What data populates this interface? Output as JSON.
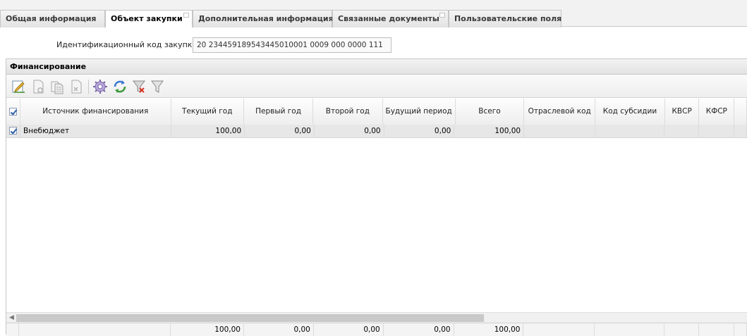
{
  "tabs": [
    {
      "label": "Общая информация"
    },
    {
      "label": "Объект закупки"
    },
    {
      "label": "Дополнительная информация"
    },
    {
      "label": "Связанные документы"
    },
    {
      "label": "Пользовательские поля"
    }
  ],
  "id_field": {
    "label": "Идентификационный код закупки:",
    "value": "20 234459189543445010001 0009 000 0000 111"
  },
  "financing": {
    "title": "Финансирование",
    "toolbar": [
      {
        "icon": "edit-icon"
      },
      {
        "icon": "add-row-icon"
      },
      {
        "icon": "copy-row-icon"
      },
      {
        "icon": "delete-row-icon"
      },
      {
        "icon": "settings-icon"
      },
      {
        "icon": "refresh-icon"
      },
      {
        "icon": "clear-filter-icon"
      },
      {
        "icon": "filter-icon"
      }
    ],
    "columns": [
      "Источник финансирования",
      "Текущий год",
      "Первый год",
      "Второй год",
      "Будущий период",
      "Всего",
      "Отраслевой код",
      "Код субсидии",
      "КВСР",
      "КФСР"
    ],
    "rows": [
      {
        "checked": true,
        "source": "Внебюджет",
        "current": "100,00",
        "first": "0,00",
        "second": "0,00",
        "future": "0,00",
        "total": "100,00",
        "industry": "",
        "subsidy": "",
        "kvsr": "",
        "kfsr": ""
      }
    ],
    "totals": {
      "current": "100,00",
      "first": "0,00",
      "second": "0,00",
      "future": "0,00",
      "total": "100,00"
    },
    "header_checked": true
  }
}
